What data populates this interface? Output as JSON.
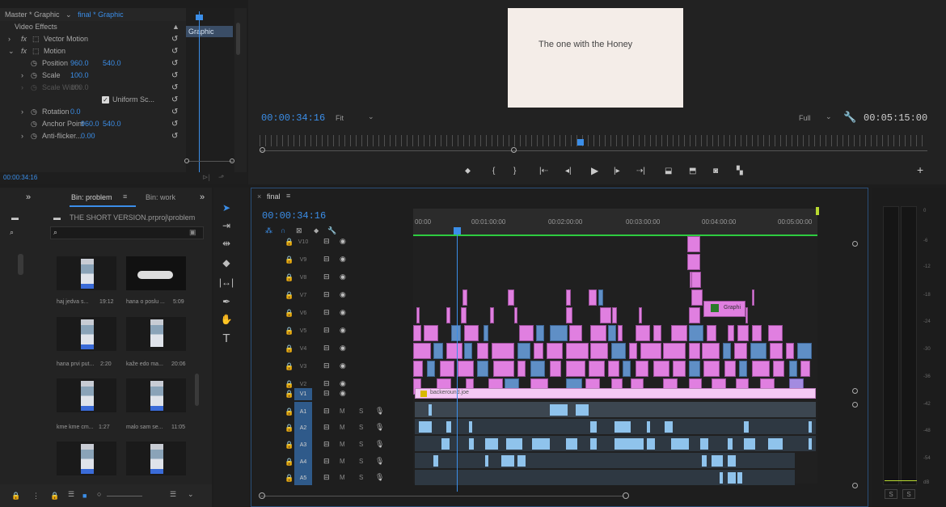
{
  "effect_controls": {
    "header_master": "Master * Graphic",
    "header_seq": "final * Graphic",
    "section": "Video Effects",
    "clip_label": "Graphic",
    "rows": [
      {
        "label": "Vector Motion",
        "v1": "",
        "v2": ""
      },
      {
        "label": "Motion",
        "v1": "",
        "v2": ""
      },
      {
        "label": "Position",
        "v1": "960.0",
        "v2": "540.0"
      },
      {
        "label": "Scale",
        "v1": "100.0",
        "v2": ""
      },
      {
        "label": "Scale Width",
        "v1": "100.0",
        "v2": ""
      },
      {
        "label": "Uniform Sc...",
        "v1": "",
        "v2": ""
      },
      {
        "label": "Rotation",
        "v1": "0.0",
        "v2": ""
      },
      {
        "label": "Anchor Point",
        "v1": "960.0",
        "v2": "540.0"
      },
      {
        "label": "Anti-flicker...",
        "v1": "0.00",
        "v2": ""
      }
    ],
    "timecode": "00:00:34:16"
  },
  "program": {
    "title_text": "The one with the Honey",
    "timecode": "00:00:34:16",
    "fit": "Fit",
    "quality": "Full",
    "duration": "00:05:15:00"
  },
  "project": {
    "tab_active": "Bin: problem",
    "tab_other": "Bin: work",
    "path": "THE SHORT VERSION.prproj\\problem",
    "items": [
      {
        "name": "haj jedva s...",
        "dur": "19:12"
      },
      {
        "name": "hana o poslu ...",
        "dur": "5:09"
      },
      {
        "name": "hana prvi put...",
        "dur": "2:20"
      },
      {
        "name": "kaže edo ma...",
        "dur": "20:06"
      },
      {
        "name": "kme kme cm...",
        "dur": "1:27"
      },
      {
        "name": "malo sam se...",
        "dur": "11:05"
      }
    ]
  },
  "timeline": {
    "sequence": "final",
    "timecode": "00:00:34:16",
    "ruler": [
      "00:00",
      "00:01:00:00",
      "00:02:00:00",
      "00:03:00:00",
      "00:04:00:00",
      "00:05:00:00"
    ],
    "video_tracks": [
      "V10",
      "V9",
      "V8",
      "V7",
      "V6",
      "V5",
      "V4",
      "V3",
      "V2",
      "V1"
    ],
    "audio_tracks": [
      "A1",
      "A2",
      "A3",
      "A4",
      "A5"
    ],
    "bg_clip": "backeround.joe",
    "graphic_clip": "Graphi",
    "mute": "M",
    "solo": "S"
  },
  "meters": {
    "ticks": [
      "0",
      "-6",
      "-12",
      "-18",
      "-24",
      "-30",
      "-36",
      "-42",
      "-48",
      "-54",
      "dB"
    ],
    "solo_a": "S",
    "solo_b": "S"
  },
  "colors": {
    "accent": "#3b8ee8",
    "pink_clip": "#e07fe0",
    "blue_clip": "#5f8fc6",
    "wave": "#8fc3ec"
  }
}
